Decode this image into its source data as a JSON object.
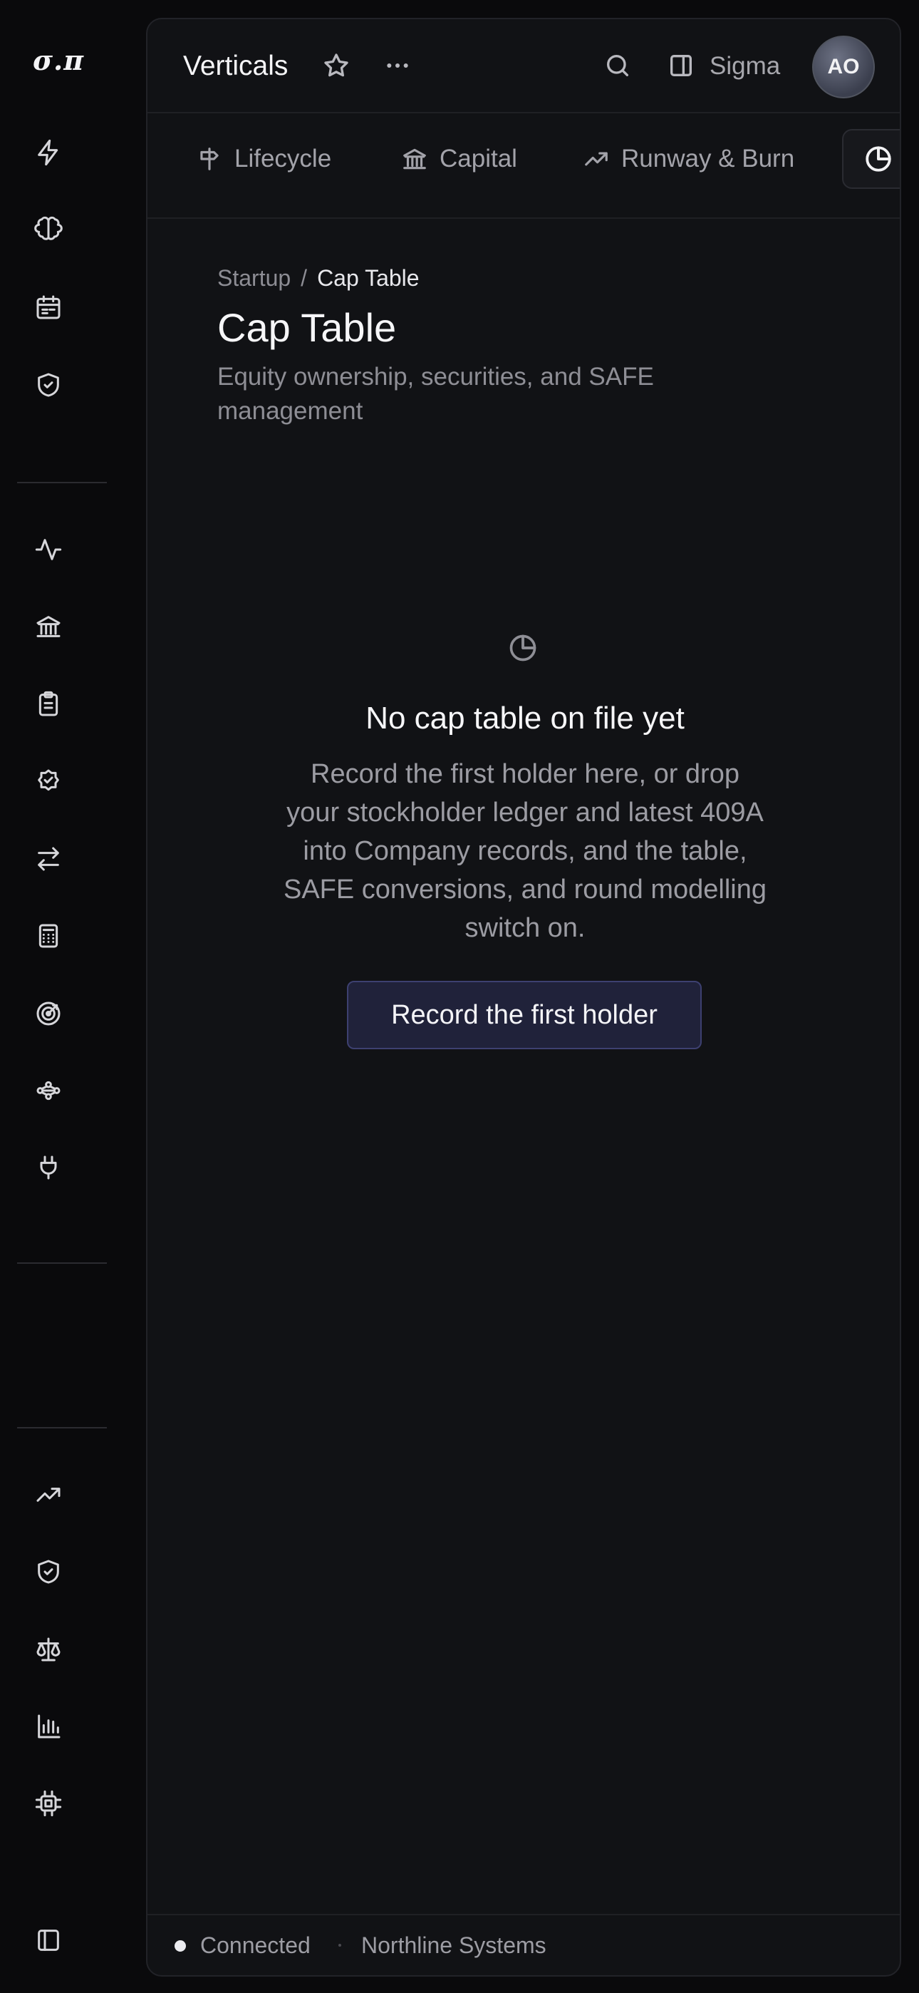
{
  "app": {
    "logo": "σ.π"
  },
  "header": {
    "title": "Verticals",
    "workspace": "Sigma",
    "avatar_initials": "AO"
  },
  "tabs": [
    {
      "label": "Lifecycle",
      "icon": "signpost-icon"
    },
    {
      "label": "Capital",
      "icon": "bank-icon"
    },
    {
      "label": "Runway & Burn",
      "icon": "trending-up-icon"
    },
    {
      "label": "",
      "icon": "pie-chart-icon",
      "active": true
    }
  ],
  "breadcrumb": {
    "parent": "Startup",
    "separator": "/",
    "current": "Cap Table"
  },
  "page": {
    "title": "Cap Table",
    "subtitle": "Equity ownership, securities, and SAFE management"
  },
  "empty_state": {
    "icon": "pie-chart-icon",
    "title": "No cap table on file yet",
    "text": "Record the first holder here, or drop your stockholder ledger and latest 409A into Company records, and the table, SAFE conversions, and round modelling switch on.",
    "button_label": "Record the first holder"
  },
  "status_bar": {
    "connection": "Connected",
    "organization": "Northline Systems"
  },
  "colors": {
    "background": "#0a0a0c",
    "panel": "#111215",
    "button_bg": "#20223a",
    "button_border": "#3d4070"
  }
}
